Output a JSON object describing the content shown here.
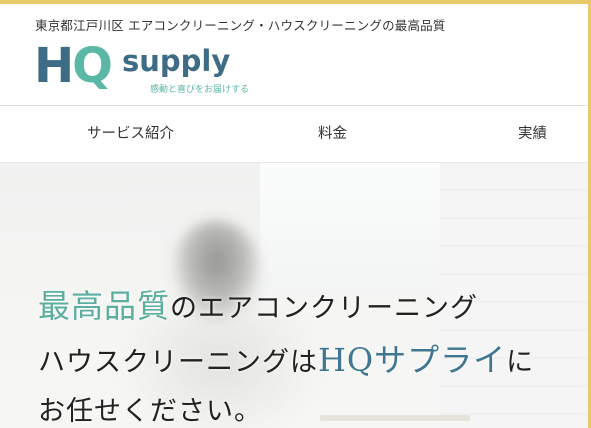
{
  "header": {
    "tagline": "東京都江戸川区 エアコンクリーニング・ハウスクリーニングの最高品質",
    "logo": {
      "hq_h": "H",
      "hq_q": "Q",
      "word": "supply",
      "subtitle": "感動と喜びをお届けする"
    }
  },
  "nav": {
    "items": [
      {
        "label": "サービス紹介"
      },
      {
        "label": "料金"
      },
      {
        "label": "実績"
      }
    ]
  },
  "hero": {
    "line1_accent": "最高品質",
    "line1_rest": "のエアコンクリーニング",
    "line2_start": "ハウスクリーニングは",
    "line2_accent": "HQサプライ",
    "line2_end": "に",
    "line3": "お任せください。"
  },
  "colors": {
    "brand_blue": "#3d6c84",
    "brand_teal": "#5cb8a6",
    "accent_gold": "#e9c867"
  }
}
